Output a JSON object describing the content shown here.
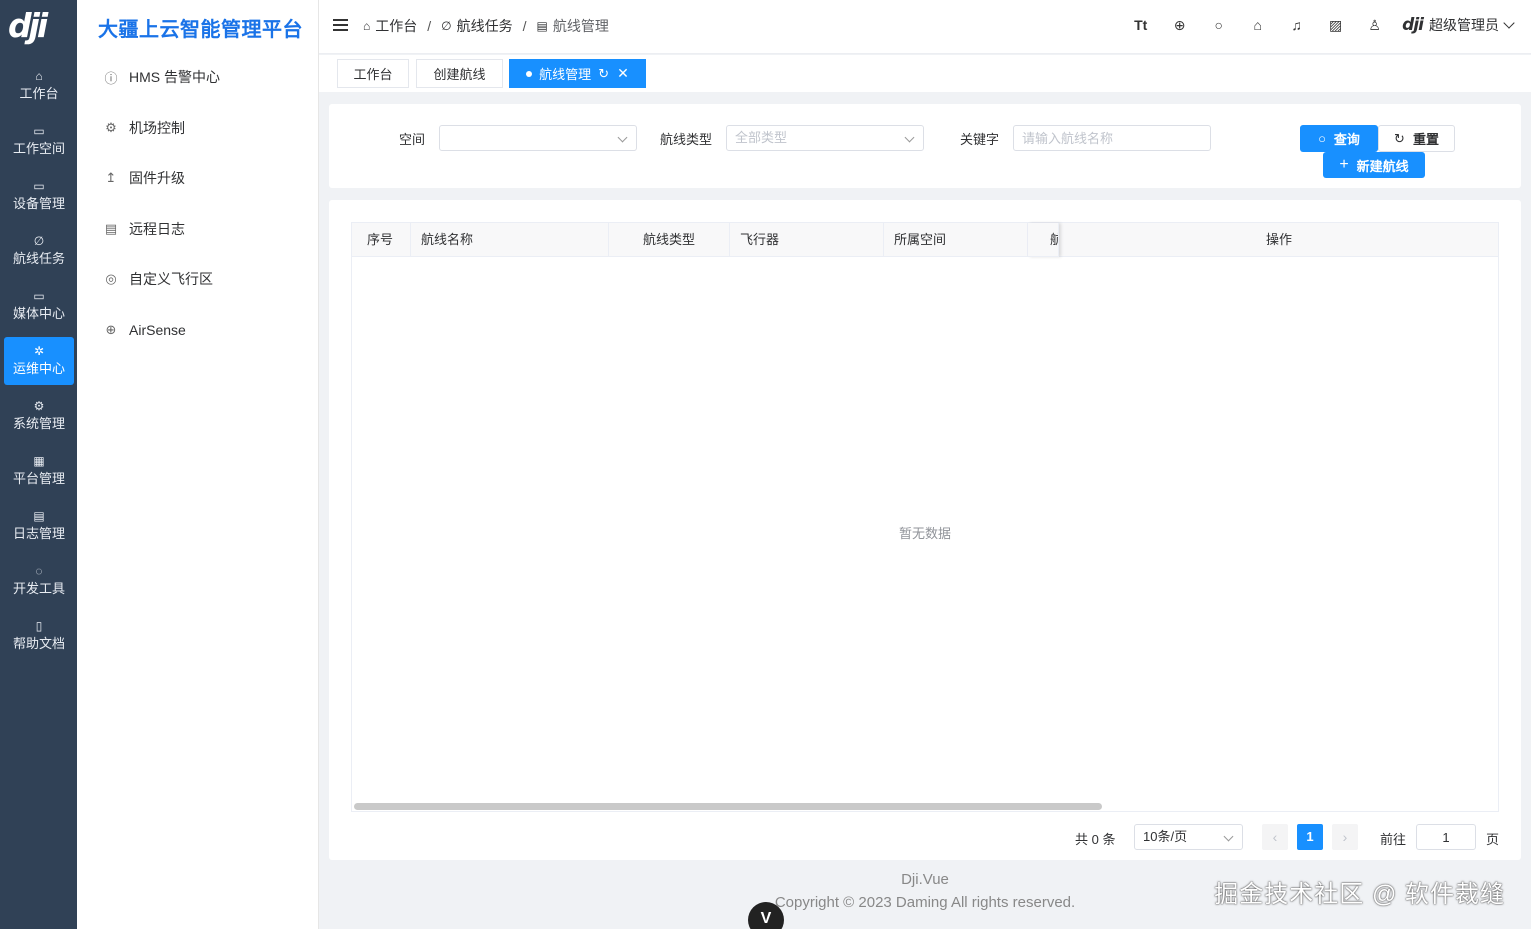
{
  "app": {
    "logo_text": "dji",
    "title": "大疆上云智能管理平台"
  },
  "rail": [
    {
      "icon": "home-icon",
      "glyph": "⌂",
      "label": "工作台",
      "active": false
    },
    {
      "icon": "briefcase-icon",
      "glyph": "▭",
      "label": "工作空间",
      "active": false
    },
    {
      "icon": "device-icon",
      "glyph": "▭",
      "label": "设备管理",
      "active": false
    },
    {
      "icon": "link-icon",
      "glyph": "∅",
      "label": "航线任务",
      "active": false
    },
    {
      "icon": "video-icon",
      "glyph": "▭",
      "label": "媒体中心",
      "active": false
    },
    {
      "icon": "gear-icon",
      "glyph": "✲",
      "label": "运维中心",
      "active": true
    },
    {
      "icon": "settings-icon",
      "glyph": "⚙",
      "label": "系统管理",
      "active": false
    },
    {
      "icon": "grid-icon",
      "glyph": "▦",
      "label": "平台管理",
      "active": false
    },
    {
      "icon": "log-icon",
      "glyph": "▤",
      "label": "日志管理",
      "active": false
    },
    {
      "icon": "chip-icon",
      "glyph": "◌",
      "label": "开发工具",
      "active": false
    },
    {
      "icon": "book-icon",
      "glyph": "▯",
      "label": "帮助文档",
      "active": false
    }
  ],
  "submenu": [
    {
      "icon": "alert-circle-icon",
      "glyph": "ⓘ",
      "label": "HMS 告警中心"
    },
    {
      "icon": "gear-icon",
      "glyph": "⚙",
      "label": "机场控制"
    },
    {
      "icon": "upload-icon",
      "glyph": "↥",
      "label": "固件升级"
    },
    {
      "icon": "document-icon",
      "glyph": "▤",
      "label": "远程日志"
    },
    {
      "icon": "location-pin-icon",
      "glyph": "◎",
      "label": "自定义飞行区"
    },
    {
      "icon": "crosshair-icon",
      "glyph": "⊕",
      "label": "AirSense"
    }
  ],
  "breadcrumb": {
    "home": "工作台",
    "middle": "航线任务",
    "current": "航线管理"
  },
  "header_tools": [
    "font-size-icon",
    "plus-circle-icon",
    "search-icon",
    "shirt-icon",
    "bell-icon",
    "chart-icon",
    "user-icon"
  ],
  "header_tool_glyphs": [
    "Tt",
    "⊕",
    "○",
    "⌂",
    "♫",
    "▨",
    "♙"
  ],
  "user": {
    "brand": "dji",
    "name": "超级管理员"
  },
  "tabs": [
    {
      "label": "工作台",
      "active": false
    },
    {
      "label": "创建航线",
      "active": false
    },
    {
      "label": "航线管理",
      "active": true
    }
  ],
  "filters": {
    "space_label": "空间",
    "space_value": "",
    "type_label": "航线类型",
    "type_placeholder": "全部类型",
    "keyword_label": "关键字",
    "keyword_placeholder": "请输入航线名称",
    "search_button": "查询",
    "reset_button": "重置",
    "new_button": "新建航线"
  },
  "table": {
    "columns": [
      "序号",
      "航线名称",
      "航线类型",
      "飞行器",
      "所属空间",
      "航",
      "操作"
    ],
    "empty_text": "暂无数据"
  },
  "pagination": {
    "total_text": "共 0 条",
    "page_size": "10条/页",
    "current_page": "1",
    "goto_label": "前往",
    "goto_value": "1",
    "page_suffix": "页"
  },
  "footer": {
    "line1": "Dji.Vue",
    "line2": "Copyright © 2023 Daming All rights reserved."
  },
  "watermark": "掘金技术社区 @ 软件裁缝",
  "floating_button": "V",
  "colors": {
    "rail_bg": "#304156",
    "accent": "#1890ff",
    "brand_title": "#1a73e8"
  }
}
